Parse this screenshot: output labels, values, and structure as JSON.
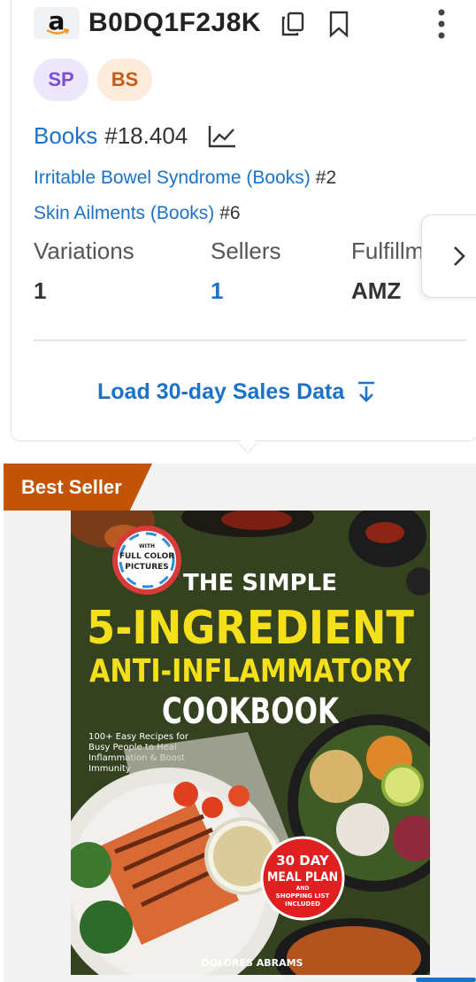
{
  "product": {
    "marketplace_icon": "amazon-logo",
    "asin": "B0DQ1F2J8K",
    "badges": [
      {
        "label": "SP",
        "bg": "#ece7fb",
        "fg": "#7a4fd6"
      },
      {
        "label": "BS",
        "bg": "#fdebdc",
        "fg": "#c45b18"
      }
    ]
  },
  "ranks": {
    "main": {
      "category": "Books",
      "rank": "#18.404"
    },
    "sub": [
      {
        "category": "Irritable Bowel Syndrome (Books)",
        "rank": "#2"
      },
      {
        "category": "Skin Ailments (Books)",
        "rank": "#6"
      }
    ]
  },
  "stats": {
    "variations": {
      "label": "Variations",
      "value": "1"
    },
    "sellers": {
      "label": "Sellers",
      "value": "1"
    },
    "fulfillment": {
      "label": "Fulfillment",
      "value": "AMZ"
    }
  },
  "actions": {
    "load_sales": "Load 30-day Sales Data"
  },
  "image_section": {
    "ribbon": "Best Seller"
  },
  "book_cover": {
    "badge_line1": "WITH",
    "badge_line2": "FULL COLOR",
    "badge_line3": "PICTURES",
    "title_line1": "THE SIMPLE",
    "title_line2": "5-INGREDIENT",
    "title_line3": "ANTI-INFLAMMATORY",
    "title_line4": "COOKBOOK",
    "subtitle_1": "100+ Easy Recipes for",
    "subtitle_2": "Busy People to Heal",
    "subtitle_3": "Inflammation & Boost",
    "subtitle_4": "Immunity",
    "seal_line1": "30 DAY",
    "seal_line2": "MEAL PLAN",
    "seal_line3": "AND",
    "seal_line4": "SHOPPING LIST",
    "seal_line5": "INCLUDED",
    "author": "DOLORES ABRAMS"
  },
  "colors": {
    "link": "#1a73c9",
    "ribbon": "#c25408",
    "title_yellow": "#f4e01a"
  }
}
